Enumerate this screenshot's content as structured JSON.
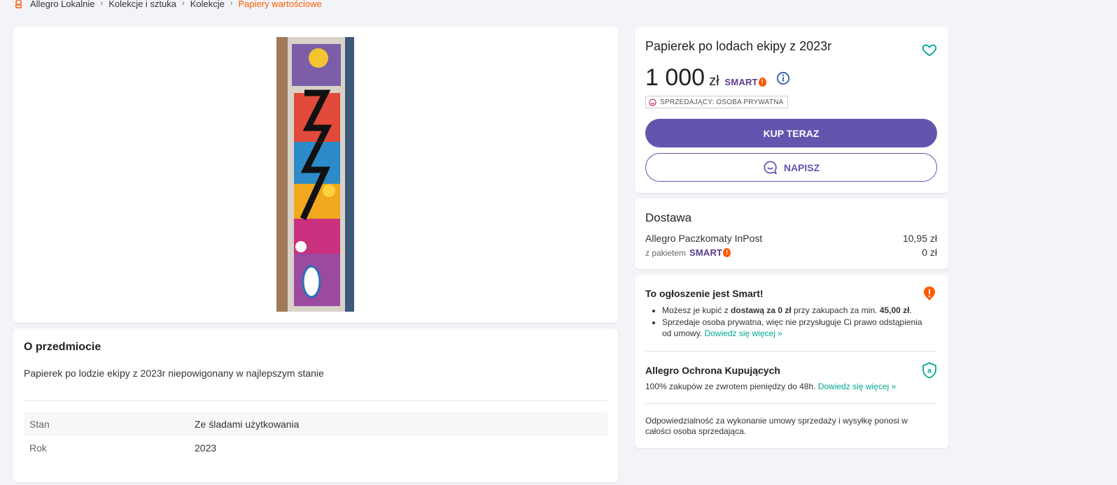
{
  "breadcrumb": {
    "items": [
      "Allegro Lokalnie",
      "Kolekcje i sztuka",
      "Kolekcje",
      "Papiery wartościowe"
    ]
  },
  "colors": {
    "accent": "#6355ae",
    "brand_orange": "#ff5a00",
    "link": "#00a790"
  },
  "about": {
    "title": "O przedmiocie",
    "description": "Papierek po lodzie ekipy z 2023r niepowigonany w najlepszym stanie",
    "attributes": [
      {
        "key": "Stan",
        "value": "Ze śladami użytkowania"
      },
      {
        "key": "Rok",
        "value": "2023"
      }
    ]
  },
  "offer": {
    "title": "Papierek po lodach ekipy z 2023r",
    "price_amount": "1 000",
    "price_currency": "zł",
    "smart_label": "SMART",
    "seller_badge": "SPRZEDAJĄCY: OSOBA PRYWATNA",
    "buy_label": "KUP TERAZ",
    "message_label": "NAPISZ"
  },
  "delivery": {
    "title": "Dostawa",
    "method": "Allegro Paczkomaty InPost",
    "cost": "10,95 zł",
    "package_label": "z pakietem",
    "package_cost": "0 zł"
  },
  "smart_info": {
    "title": "To ogłoszenie jest Smart!",
    "bullet1_a": "Możesz je kupić z ",
    "bullet1_b": "dostawą za 0 zł",
    "bullet1_c": " przy zakupach za min. ",
    "bullet1_d": "45,00 zł",
    "bullet1_e": ".",
    "bullet2": "Sprzedaje osoba prywatna, więc nie przysługuje Ci prawo odstąpienia od umowy.",
    "learn_more": "Dowiedz się więcej »"
  },
  "protection": {
    "title": "Allegro Ochrona Kupujących",
    "text": "100% zakupów ze zwrotem pieniędzy do 48h.",
    "learn_more": "Dowiedz się więcej »"
  },
  "liability": "Odpowiedzialność za wykonanie umowy sprzedaży i wysyłkę ponosi w całości osoba sprzedająca."
}
